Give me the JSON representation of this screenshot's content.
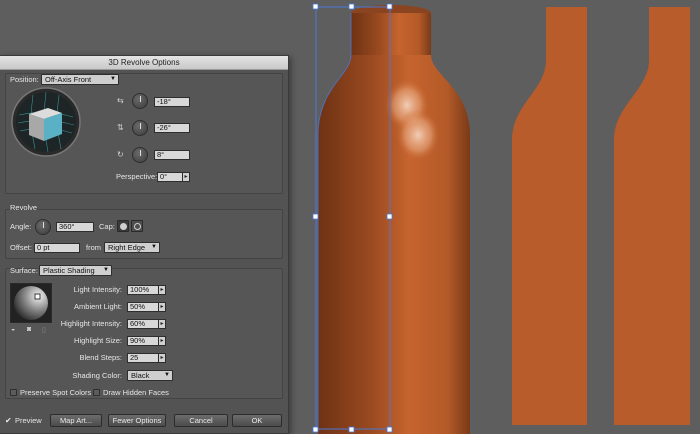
{
  "dialog": {
    "title": "3D Revolve Options",
    "position": {
      "label": "Position:",
      "value": "Off-Axis Front"
    },
    "rotation": {
      "x": {
        "value": "-18°",
        "icon": "rotate-x-icon"
      },
      "y": {
        "value": "-26°",
        "icon": "rotate-y-icon"
      },
      "z": {
        "value": "8°",
        "icon": "rotate-z-icon"
      }
    },
    "perspective": {
      "label": "Perspective:",
      "value": "0°"
    },
    "revolve": {
      "section": "Revolve",
      "angle_label": "Angle:",
      "angle_value": "360°",
      "cap_label": "Cap:",
      "offset_label": "Offset:",
      "offset_value": "0 pt",
      "from_label": "from",
      "from_value": "Right Edge"
    },
    "surface": {
      "label": "Surface:",
      "value": "Plastic Shading",
      "light_intensity_label": "Light Intensity:",
      "light_intensity": "100%",
      "ambient_light_label": "Ambient Light:",
      "ambient_light": "50%",
      "highlight_intensity_label": "Highlight Intensity:",
      "highlight_intensity": "60%",
      "highlight_size_label": "Highlight Size:",
      "highlight_size": "90%",
      "blend_steps_label": "Blend Steps:",
      "blend_steps": "25",
      "shading_color_label": "Shading Color:",
      "shading_color": "Black",
      "preserve_spot_colors": "Preserve Spot Colors",
      "draw_hidden_faces": "Draw Hidden Faces"
    },
    "buttons": {
      "preview": "Preview",
      "map_art": "Map Art...",
      "fewer_options": "Fewer Options",
      "cancel": "Cancel",
      "ok": "OK"
    }
  },
  "colors": {
    "bottle": "#b85c2c",
    "canvas": "#5e5e5e",
    "selection": "#4a78d8",
    "cube_face": "#5ab0c4"
  }
}
